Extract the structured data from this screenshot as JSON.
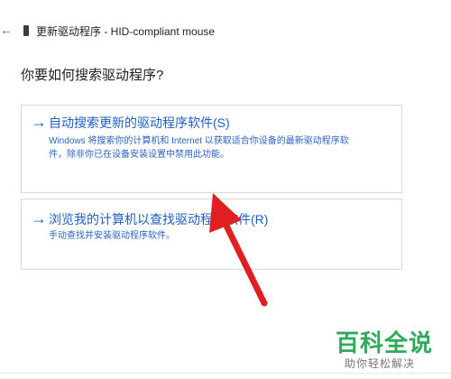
{
  "window": {
    "back_icon": "back-arrow-icon",
    "device_icon": "device-icon",
    "title": "更新驱动程序 - HID-compliant mouse"
  },
  "main": {
    "heading": "你要如何搜索驱动程序?",
    "options": [
      {
        "icon": "arrow-right-icon",
        "title": "自动搜索更新的驱动程序软件(S)",
        "description_line1": "Windows 将搜索你的计算机和 Internet 以获取适合你设备的最新驱动程序软",
        "description_line2": "件，除非你已在设备安装设置中禁用此功能。"
      },
      {
        "icon": "arrow-right-icon",
        "title": "浏览我的计算机以查找驱动程序软件(R)",
        "description_line1": "手动查找并安装驱动程序软件。"
      }
    ]
  },
  "annotation": {
    "icon": "red-pointer-arrow",
    "color": "#e02020"
  },
  "watermark": {
    "logo_text": "百科全说",
    "tagline": "助你轻松解决",
    "color": "#2eab5a"
  }
}
